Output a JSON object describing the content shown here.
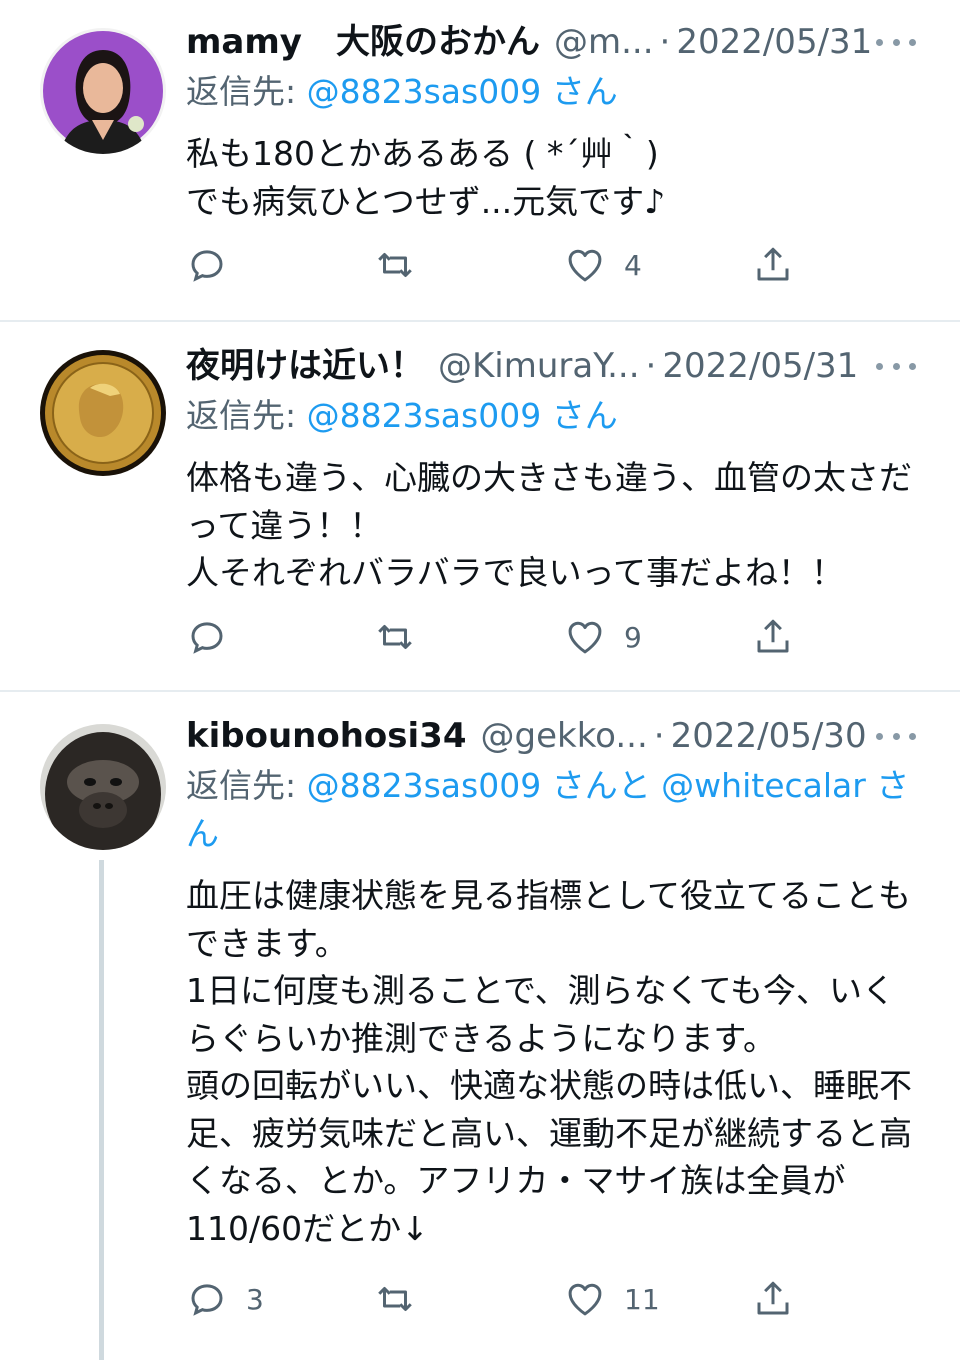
{
  "colors": {
    "link": "#1d9bf0",
    "muted": "#536471",
    "divider": "#e6ecf0"
  },
  "tweets": [
    {
      "name": "mamy　大阪のおかん",
      "handle": "@m...",
      "date": "2022/05/31",
      "reply_prefix": "返信先:",
      "reply_to": "@8823sas009 さん",
      "body": "私も180とかあるある ( *´艸｀)\nでも病気ひとつせず...元気です♪",
      "reply_count": "",
      "like_count": "4"
    },
    {
      "name": "夜明けは近い！",
      "handle": "@KimuraY...",
      "date": "2022/05/31",
      "reply_prefix": "返信先:",
      "reply_to": "@8823sas009 さん",
      "body": "体格も違う、心臓の大きさも違う、血管の太さだって違う！！\n人それぞれバラバラで良いって事だよね！！",
      "reply_count": "",
      "like_count": "9"
    },
    {
      "name": "kibounohosi34",
      "handle": "@gekko...",
      "date": "2022/05/30",
      "reply_prefix": "返信先:",
      "reply_to": "@8823sas009 さんと @whitecalar さん",
      "body": "血圧は健康状態を見る指標として役立てることもできます。\n1日に何度も測ることで、測らなくても今、いくらぐらいか推測できるようになります。\n頭の回転がいい、快適な状態の時は低い、睡眠不足、疲労気味だと高い、運動不足が継続すると高くなる、とか。アフリカ・マサイ族は全員が110/60だとか↓",
      "reply_count": "3",
      "like_count": "11"
    }
  ],
  "icons": {
    "reply": "reply-icon",
    "retweet": "retweet-icon",
    "like": "heart-icon",
    "share": "share-icon",
    "more": "more-icon"
  }
}
